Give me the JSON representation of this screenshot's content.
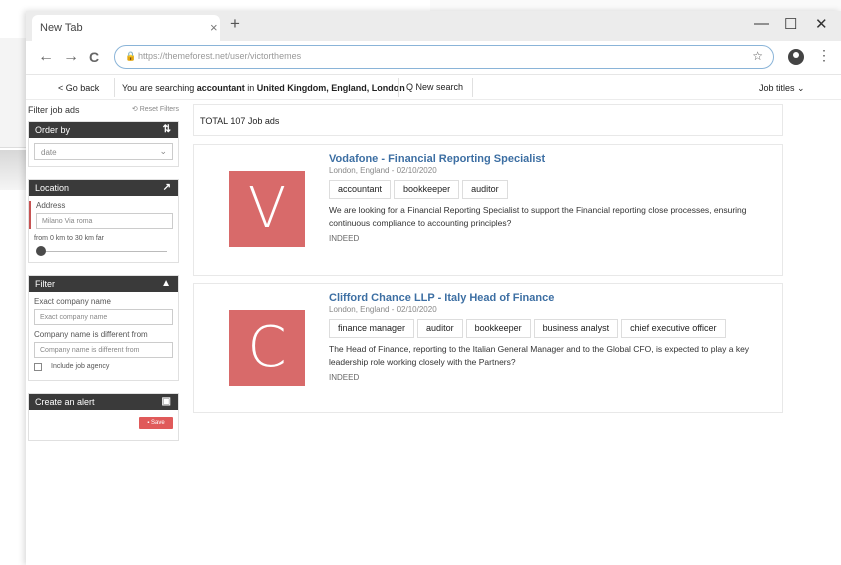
{
  "browser": {
    "tab_title": "New Tab",
    "tab_close": "×",
    "new_tab": "+",
    "minimize": "—",
    "maximize": "☐",
    "close": "✕",
    "back": "←",
    "forward": "→",
    "reload": "C",
    "url": "https://themeforest.net/user/victorthemes",
    "star": "☆",
    "menu": "⋮"
  },
  "searchbar": {
    "go_back": "< Go back",
    "searching_prefix": "You are searching ",
    "query": "accountant",
    "in_text": " in ",
    "location": "United Kingdom, England, London",
    "new_search": "Q New search",
    "job_titles": "Job titles ⌄"
  },
  "sidebar": {
    "filter_title": "Filter job ads",
    "reset_filters": "⟲ Reset Filters",
    "order_by": {
      "title": "Order by",
      "icon": "⇅",
      "value": "date"
    },
    "location": {
      "title": "Location",
      "icon": "↗",
      "address_label": "Address",
      "address_value": "Milano Via roma",
      "range_text": "from 0 km to 30 km far",
      "slider_value": 0
    },
    "filters": {
      "title": "Filter",
      "icon": "▲",
      "exact_label": "Exact company name",
      "exact_placeholder": "Exact company name",
      "different_label": "Company name is different from",
      "different_placeholder": "Company name is different from",
      "agency_label": "Include job agency"
    },
    "alert": {
      "title": "Create an alert",
      "icon": "🖫",
      "save_label": "Save"
    }
  },
  "results": {
    "total": "TOTAL 107 Job ads",
    "jobs": [
      {
        "logo": "V",
        "title": "Vodafone - Financial Reporting Specialist",
        "meta": "London, England - 02/10/2020",
        "tags": [
          "accountant",
          "bookkeeper",
          "auditor"
        ],
        "description": "We are looking for a Financial Reporting Specialist to support the Financial reporting close processes, ensuring continuous compliance to accounting principles?",
        "source": "INDEED"
      },
      {
        "logo": "C",
        "title": "Clifford Chance LLP - Italy Head of Finance",
        "meta": "London, England - 02/10/2020",
        "tags": [
          "finance manager",
          "auditor",
          "bookkeeper",
          "business analyst",
          "chief executive officer"
        ],
        "description": "The Head of Finance, reporting to the Italian General Manager and to the Global CFO, is expected to play a key leadership role working closely with the Partners?",
        "source": "INDEED"
      }
    ]
  }
}
